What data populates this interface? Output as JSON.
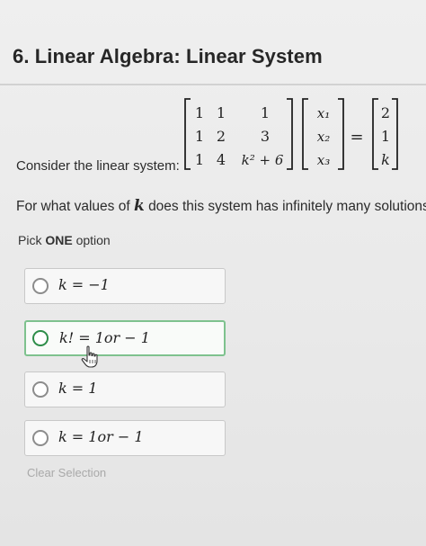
{
  "question": {
    "title": "6. Linear Algebra: Linear System",
    "prompt": "Consider the linear system:",
    "matrix_A": [
      [
        "1",
        "1",
        "1"
      ],
      [
        "1",
        "2",
        "3"
      ],
      [
        "1",
        "4",
        "k² + 6"
      ]
    ],
    "vector_x": [
      "x₁",
      "x₂",
      "x₃"
    ],
    "equals": "=",
    "vector_b": [
      "2",
      "1",
      "k"
    ],
    "ask_before": "For what values of",
    "ask_var": "k",
    "ask_after": "does this system has infinitely many solutions?"
  },
  "pick": {
    "prefix": "Pick",
    "strong": "ONE",
    "suffix": "option"
  },
  "options": [
    {
      "label": "k = −1"
    },
    {
      "label": "k! = 1or − 1"
    },
    {
      "label": "k = 1"
    },
    {
      "label": "k = 1or − 1"
    }
  ],
  "clear_label": "Clear Selection",
  "colors": {
    "hover_border": "#7ec28e",
    "radio_hover": "#2e8d49",
    "background": "#ebebeb"
  },
  "icons": {
    "cursor": "hand-pointer-icon"
  }
}
